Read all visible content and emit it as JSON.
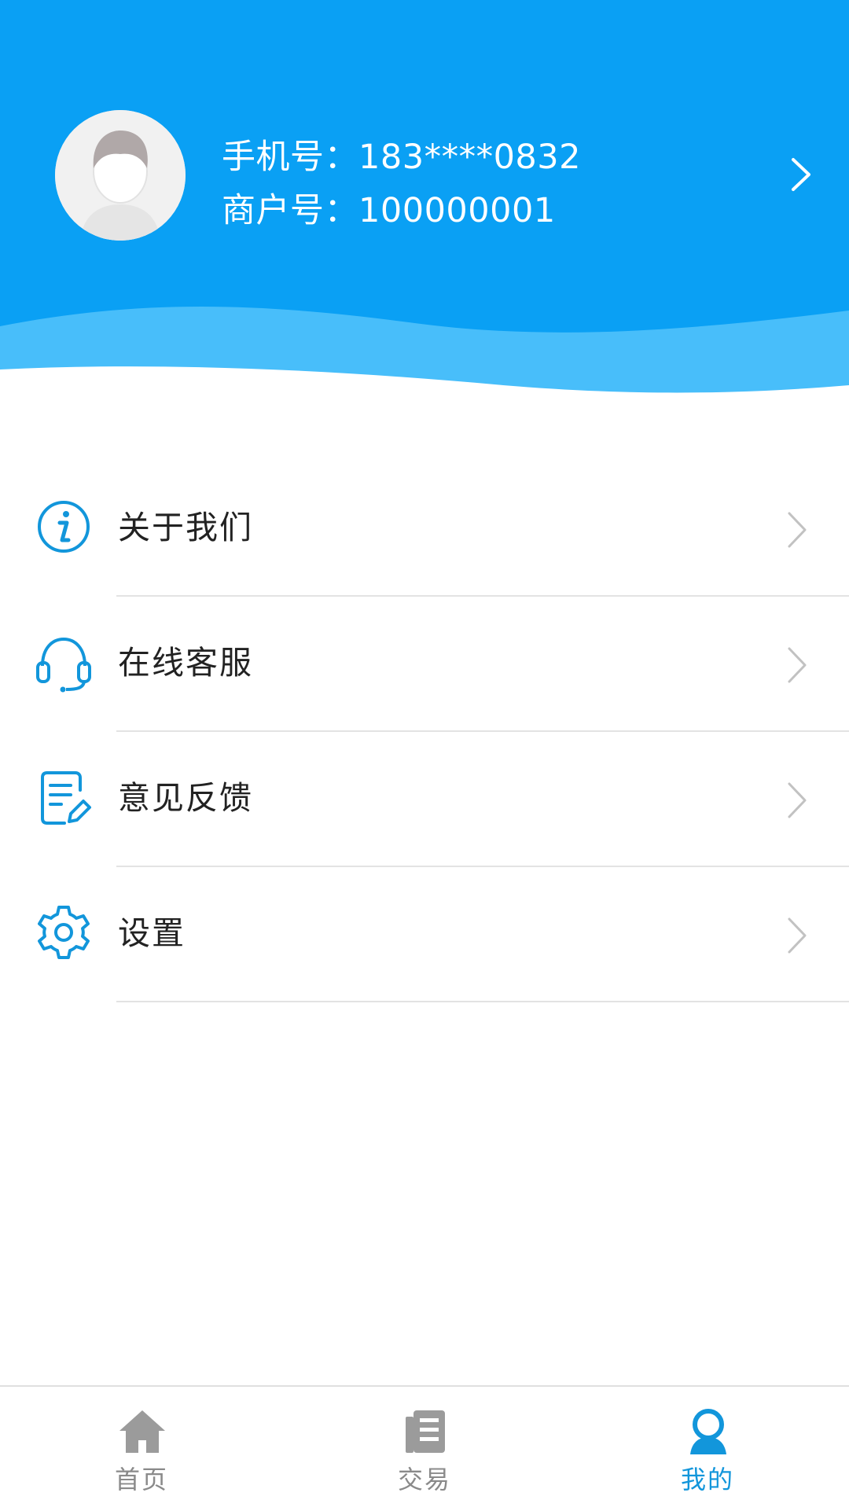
{
  "profile": {
    "phone_label": "手机号：",
    "phone_value": "183****0832",
    "merchant_label": "商户号：",
    "merchant_value": "100000001"
  },
  "menu": {
    "items": [
      {
        "label": "关于我们",
        "icon": "info-circle-icon"
      },
      {
        "label": "在线客服",
        "icon": "headset-icon"
      },
      {
        "label": "意见反馈",
        "icon": "feedback-edit-icon"
      },
      {
        "label": "设置",
        "icon": "gear-icon"
      }
    ]
  },
  "tabbar": {
    "items": [
      {
        "label": "首页",
        "icon": "home-icon",
        "active": false
      },
      {
        "label": "交易",
        "icon": "document-list-icon",
        "active": false
      },
      {
        "label": "我的",
        "icon": "user-icon",
        "active": true
      }
    ]
  },
  "colors": {
    "header_blue": "#0aa0f4",
    "accent_blue": "#1296db",
    "inactive_gray": "#8a8a8a"
  }
}
